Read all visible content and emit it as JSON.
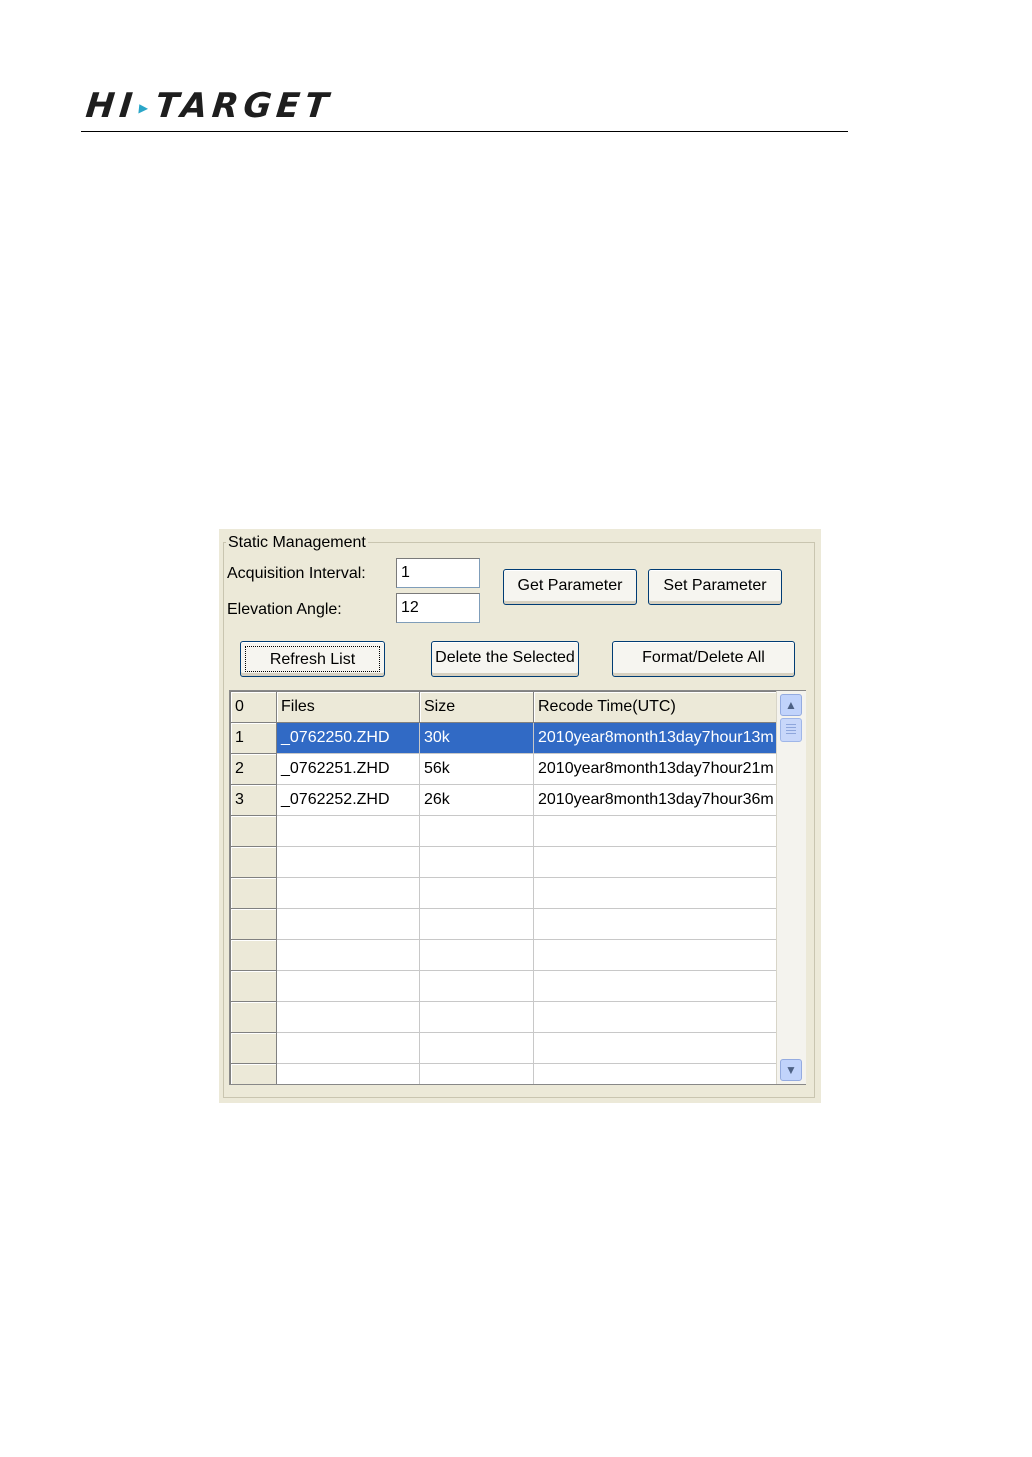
{
  "header": {
    "logo_left": "HI",
    "logo_right": "TARGET"
  },
  "panel": {
    "title": "Static Management",
    "acquisition_label": "Acquisition Interval:",
    "acquisition_value": "1",
    "elevation_label": "Elevation Angle:",
    "elevation_value": "12",
    "get_parameter": "Get Parameter",
    "set_parameter": "Set Parameter",
    "refresh_list": "Refresh List",
    "delete_selected": "Delete the Selected",
    "format_delete_all": "Format/Delete All"
  },
  "table": {
    "headers": [
      "0",
      "Files",
      "Size",
      "Recode Time(UTC)"
    ],
    "rows": [
      [
        "1",
        "_0762250.ZHD",
        "30k",
        "2010year8month13day7hour13m"
      ],
      [
        "2",
        "_0762251.ZHD",
        "56k",
        "2010year8month13day7hour21m"
      ],
      [
        "3",
        "_0762252.ZHD",
        "26k",
        "2010year8month13day7hour36m"
      ],
      [
        "",
        "",
        "",
        ""
      ],
      [
        "",
        "",
        "",
        ""
      ],
      [
        "",
        "",
        "",
        ""
      ],
      [
        "",
        "",
        "",
        ""
      ],
      [
        "",
        "",
        "",
        ""
      ],
      [
        "",
        "",
        "",
        ""
      ],
      [
        "",
        "",
        "",
        ""
      ],
      [
        "",
        "",
        "",
        ""
      ],
      [
        "",
        "",
        "",
        ""
      ]
    ],
    "selected_row": 0
  },
  "colors": {
    "selection": "#316ac5",
    "panel_bg": "#ece9d8",
    "logo_accent": "#2aa6c8"
  }
}
